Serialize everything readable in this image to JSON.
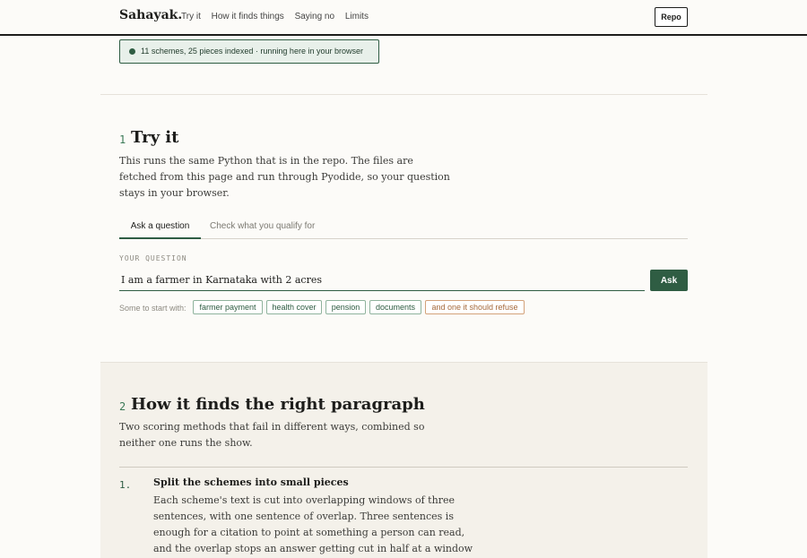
{
  "header": {
    "brand": "Sahayak.",
    "nav": [
      "Try it",
      "How it finds things",
      "Saying no",
      "Limits"
    ],
    "repo_label": "Repo"
  },
  "status": {
    "text": "11 schemes, 25 pieces indexed · running here in your browser",
    "color": "#2f5d43"
  },
  "try_it": {
    "number": "1",
    "title": "Try it",
    "description": "This runs the same Python that is in the repo. The files are fetched from this page and run through Pyodide, so your question stays in your browser.",
    "tabs": [
      {
        "label": "Ask a question",
        "active": true
      },
      {
        "label": "Check what you qualify for",
        "active": false
      }
    ],
    "question_label": "YOUR QUESTION",
    "question_value": "I am a farmer in Karnataka with 2 acres",
    "ask_label": "Ask",
    "start_label": "Some to start with:",
    "chips": [
      "farmer payment",
      "health cover",
      "pension",
      "documents",
      "and one it should refuse"
    ]
  },
  "how_it_finds": {
    "number": "2",
    "title": "How it finds the right paragraph",
    "description": "Two scoring methods that fail in different ways, combined so neither one runs the show.",
    "steps": [
      {
        "number": "1.",
        "title": "Split the schemes into small pieces",
        "body": "Each scheme's text is cut into overlapping windows of three sentences, with one sentence of overlap. Three sentences is enough for a citation to point at something a person can read, and the overlap stops an answer getting cut in half at a window boundary."
      }
    ]
  },
  "colors": {
    "accent": "#2f5d43",
    "refuse": "#a66a3c",
    "background": "#fcfbf8"
  }
}
